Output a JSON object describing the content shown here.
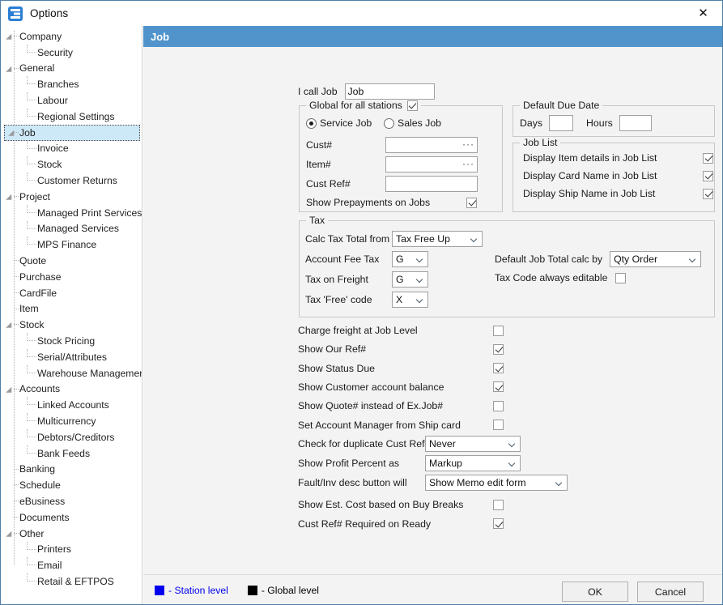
{
  "window": {
    "title": "Options",
    "app_icon": "options-app-icon",
    "close_label": "✕"
  },
  "sidebar": {
    "items": [
      {
        "label": "Company",
        "level": 0,
        "expandable": true,
        "selected": false
      },
      {
        "label": "Security",
        "level": 1,
        "expandable": false,
        "selected": false
      },
      {
        "label": "General",
        "level": 0,
        "expandable": true,
        "selected": false
      },
      {
        "label": "Branches",
        "level": 1,
        "expandable": false,
        "selected": false
      },
      {
        "label": "Labour",
        "level": 1,
        "expandable": false,
        "selected": false
      },
      {
        "label": "Regional Settings",
        "level": 1,
        "expandable": false,
        "selected": false
      },
      {
        "label": "Job",
        "level": 0,
        "expandable": true,
        "selected": true
      },
      {
        "label": "Invoice",
        "level": 1,
        "expandable": false,
        "selected": false
      },
      {
        "label": "Stock",
        "level": 1,
        "expandable": false,
        "selected": false
      },
      {
        "label": "Customer Returns",
        "level": 1,
        "expandable": false,
        "selected": false
      },
      {
        "label": "Project",
        "level": 0,
        "expandable": true,
        "selected": false
      },
      {
        "label": "Managed Print Services",
        "level": 1,
        "expandable": false,
        "selected": false
      },
      {
        "label": "Managed Services",
        "level": 1,
        "expandable": false,
        "selected": false
      },
      {
        "label": "MPS Finance",
        "level": 1,
        "expandable": false,
        "selected": false
      },
      {
        "label": "Quote",
        "level": 0,
        "expandable": false,
        "selected": false
      },
      {
        "label": "Purchase",
        "level": 0,
        "expandable": false,
        "selected": false
      },
      {
        "label": "CardFile",
        "level": 0,
        "expandable": false,
        "selected": false
      },
      {
        "label": "Item",
        "level": 0,
        "expandable": false,
        "selected": false
      },
      {
        "label": "Stock",
        "level": 0,
        "expandable": true,
        "selected": false
      },
      {
        "label": "Stock Pricing",
        "level": 1,
        "expandable": false,
        "selected": false
      },
      {
        "label": "Serial/Attributes",
        "level": 1,
        "expandable": false,
        "selected": false
      },
      {
        "label": "Warehouse Management",
        "level": 1,
        "expandable": false,
        "selected": false
      },
      {
        "label": "Accounts",
        "level": 0,
        "expandable": true,
        "selected": false
      },
      {
        "label": "Linked Accounts",
        "level": 1,
        "expandable": false,
        "selected": false
      },
      {
        "label": "Multicurrency",
        "level": 1,
        "expandable": false,
        "selected": false
      },
      {
        "label": "Debtors/Creditors",
        "level": 1,
        "expandable": false,
        "selected": false
      },
      {
        "label": "Bank Feeds",
        "level": 1,
        "expandable": false,
        "selected": false
      },
      {
        "label": "Banking",
        "level": 0,
        "expandable": false,
        "selected": false
      },
      {
        "label": "Schedule",
        "level": 0,
        "expandable": false,
        "selected": false
      },
      {
        "label": "eBusiness",
        "level": 0,
        "expandable": false,
        "selected": false
      },
      {
        "label": "Documents",
        "level": 0,
        "expandable": false,
        "selected": false
      },
      {
        "label": "Other",
        "level": 0,
        "expandable": true,
        "selected": false
      },
      {
        "label": "Printers",
        "level": 1,
        "expandable": false,
        "selected": false
      },
      {
        "label": "Email",
        "level": 1,
        "expandable": false,
        "selected": false
      },
      {
        "label": "Retail & EFTPOS",
        "level": 1,
        "expandable": false,
        "selected": false
      }
    ]
  },
  "panel": {
    "header": "Job",
    "i_call_job": {
      "label": "I call Job",
      "value": "Job"
    },
    "global_group": {
      "caption": "Global for all stations",
      "caption_checked": true,
      "service_job": {
        "label": "Service Job",
        "selected": true
      },
      "sales_job": {
        "label": "Sales Job",
        "selected": false
      },
      "cust_no": {
        "label": "Cust#",
        "value": "",
        "has_lookup": true,
        "ellipsis": "···"
      },
      "item_no": {
        "label": "Item#",
        "value": "",
        "has_lookup": true,
        "ellipsis": "···"
      },
      "cust_ref": {
        "label": "Cust Ref#",
        "value": "",
        "has_lookup": false
      },
      "show_prepayments": {
        "label": "Show Prepayments on Jobs",
        "checked": true
      }
    },
    "due_date_group": {
      "caption": "Default Due Date",
      "days": {
        "label": "Days",
        "value": ""
      },
      "hours": {
        "label": "Hours",
        "value": ""
      }
    },
    "job_list_group": {
      "caption": "Job List",
      "items": [
        {
          "label": "Display Item details in Job List",
          "checked": true
        },
        {
          "label": "Display Card Name in Job List",
          "checked": true
        },
        {
          "label": "Display Ship Name in Job List",
          "checked": true
        }
      ]
    },
    "tax_group": {
      "caption": "Tax",
      "calc_tax_total_from": {
        "label": "Calc Tax Total from",
        "value": "Tax Free Up"
      },
      "account_fee_tax": {
        "label": "Account Fee Tax",
        "value": "G"
      },
      "tax_on_freight": {
        "label": "Tax on Freight",
        "value": "G"
      },
      "tax_free_code": {
        "label": "Tax 'Free' code",
        "value": "X"
      },
      "default_job_total_calc_by": {
        "label": "Default Job Total calc by",
        "value": "Qty Order"
      },
      "tax_code_always_editable": {
        "label": "Tax Code always editable",
        "checked": false
      }
    },
    "options": [
      {
        "label": "Charge freight at Job Level",
        "checked": false
      },
      {
        "label": "Show Our Ref#",
        "checked": true
      },
      {
        "label": "Show Status Due",
        "checked": true
      },
      {
        "label": "Show Customer account balance",
        "checked": true
      },
      {
        "label": "Show Quote# instead of Ex.Job#",
        "checked": false
      },
      {
        "label": "Set Account Manager from Ship card",
        "checked": false
      }
    ],
    "selects": [
      {
        "label": "Check for duplicate Cust Ref#",
        "value": "Never"
      },
      {
        "label": "Show Profit Percent as",
        "value": "Markup"
      },
      {
        "label": "Fault/Inv desc button will",
        "value": "Show Memo edit form"
      }
    ],
    "options2": [
      {
        "label": "Show Est. Cost based on Buy Breaks",
        "checked": false
      },
      {
        "label": "Cust Ref# Required on Ready",
        "checked": true
      }
    ]
  },
  "footer": {
    "legend": [
      {
        "text": "- Station level",
        "color": "#0000ee"
      },
      {
        "text": "- Global level",
        "color": "#000000"
      }
    ],
    "ok_label": "OK",
    "cancel_label": "Cancel"
  },
  "colors": {
    "header_blue": "#5194cc",
    "selection_blue": "#cde8f7",
    "panel_bg": "#f3f3f3",
    "station_level": "#0000ee",
    "global_level": "#000000"
  }
}
